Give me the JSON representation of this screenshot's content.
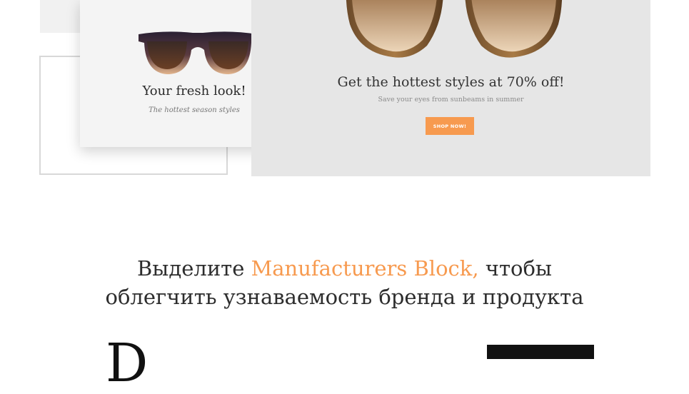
{
  "promo_card": {
    "title": "Your fresh look!",
    "subtitle": "The hottest season styles",
    "glasses_icon": "sunglasses-image"
  },
  "banner": {
    "title": "Get the hottest styles at 70% off!",
    "subtitle": "Save your eyes from sunbeams in summer",
    "button_label": "SHOP NOW!",
    "glasses_icon": "aviator-sunglasses-image"
  },
  "headline": {
    "prefix": "Выделите ",
    "accent": "Manufacturers Block,",
    "suffix_line1": " чтобы",
    "line2": "облегчить узнаваемость бренда и продукта"
  },
  "brands": {
    "left_logo_text": "D"
  },
  "colors": {
    "accent": "#f79a4f",
    "banner_bg": "#e6e6e6",
    "card_bg": "#f4f4f4"
  }
}
